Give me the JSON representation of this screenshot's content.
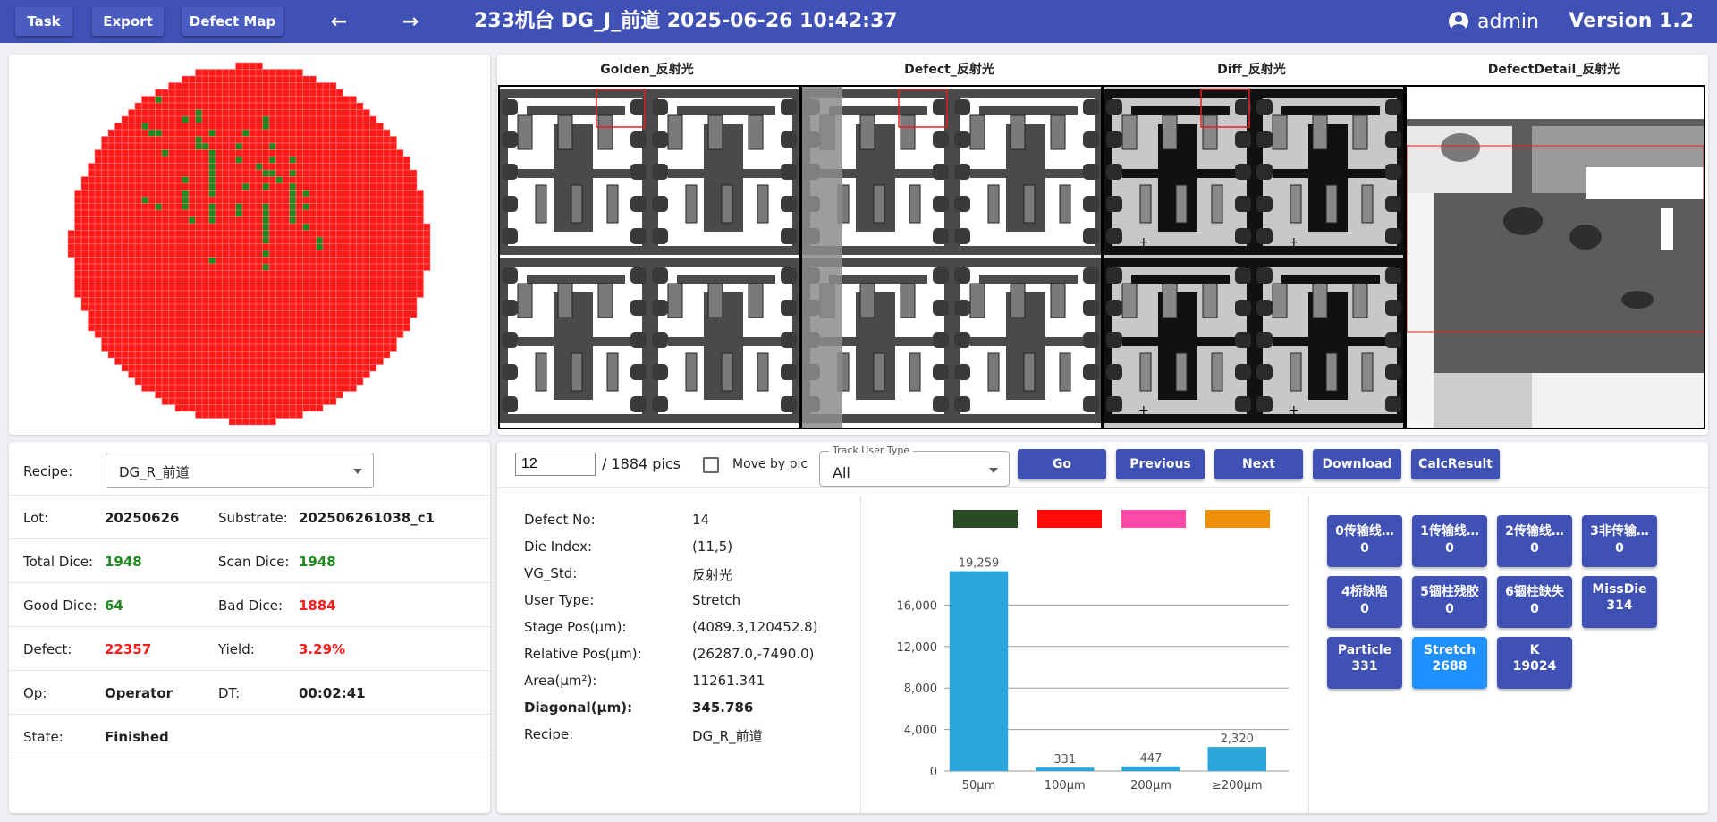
{
  "header": {
    "buttons": [
      "Task",
      "Export",
      "Defect Map"
    ],
    "back_icon": "arrow-left-icon",
    "forward_icon": "arrow-right-icon",
    "title": "233机台   DG_J_前道   2025-06-26 10:42:37",
    "user": "admin",
    "version": "Version 1.2"
  },
  "colors": {
    "header": "#3f51b5",
    "good_die": "#1e8a1e",
    "bad_die": "#ff1a1a",
    "selected_die": "#1033c8",
    "good_text": "#1e8a1e",
    "bad_text": "#ff1a1a",
    "bar": "#2ba6dc"
  },
  "info": {
    "recipe_label": "Recipe:",
    "recipe_value": "DG_R_前道",
    "lot_label": "Lot:",
    "lot_value": "20250626",
    "substrate_label": "Substrate:",
    "substrate_value": "202506261038_c1",
    "total_label": "Total Dice:",
    "total_value": "1948",
    "scan_label": "Scan Dice:",
    "scan_value": "1948",
    "good_label": "Good Dice:",
    "good_value": "64",
    "bad_label": "Bad Dice:",
    "bad_value": "1884",
    "defect_label": "Defect:",
    "defect_value": "22357",
    "yield_label": "Yield:",
    "yield_value": "3.29%",
    "op_label": "Op:",
    "op_value": "Operator",
    "dt_label": "DT:",
    "dt_value": "00:02:41",
    "state_label": "State:",
    "state_value": "Finished"
  },
  "images": {
    "titles": [
      "Golden_反射光",
      "Defect_反射光",
      "Diff_反射光",
      "DefectDetail_反射光"
    ]
  },
  "controls": {
    "pic_value": "12",
    "pic_total": "/ 1884 pics",
    "move_by_pic": "Move by pic",
    "track_label": "Track User Type",
    "track_value": "All",
    "buttons": [
      "Go",
      "Previous",
      "Next",
      "Download",
      "CalcResult"
    ]
  },
  "defect": {
    "rows": [
      {
        "label": "Defect No:",
        "value": "14"
      },
      {
        "label": "Die Index:",
        "value": "(11,5)"
      },
      {
        "label": "VG_Std:",
        "value": "反射光"
      },
      {
        "label": "User Type:",
        "value": "Stretch"
      },
      {
        "label": "Stage Pos(μm):",
        "value": "(4089.3,120452.8)"
      },
      {
        "label": "Relative Pos(μm):",
        "value": "(26287.0,-7490.0)"
      },
      {
        "label": "Area(μm²):",
        "value": "11261.341"
      },
      {
        "label": "Diagonal(μm):",
        "value": "345.786"
      },
      {
        "label": "Recipe:",
        "value": "DG_R_前道"
      }
    ]
  },
  "chart_data": {
    "type": "bar",
    "categories": [
      "50μm",
      "100μm",
      "200μm",
      "≥200μm"
    ],
    "values": [
      19259,
      331,
      447,
      2320
    ],
    "value_labels": [
      "19,259",
      "331",
      "447",
      "2,320"
    ],
    "legend_colors": [
      "#2a4a26",
      "#ff0a0a",
      "#ff4aa8",
      "#f0900a"
    ],
    "yticks": [
      "0",
      "4,000",
      "8,000",
      "12,000",
      "16,000"
    ],
    "ylim": [
      0,
      20000
    ],
    "grid": true,
    "legend_placement": "top"
  },
  "chips": [
    {
      "label": "0传输线…",
      "count": "0"
    },
    {
      "label": "1传输线…",
      "count": "0"
    },
    {
      "label": "2传输线…",
      "count": "0"
    },
    {
      "label": "3非传输…",
      "count": "0"
    },
    {
      "label": "4桥缺陷",
      "count": "0"
    },
    {
      "label": "5锢柱残胶",
      "count": "0"
    },
    {
      "label": "6锢柱缺失",
      "count": "0"
    },
    {
      "label": "MissDie",
      "count": "314"
    },
    {
      "label": "Particle",
      "count": "331"
    },
    {
      "label": "Stretch",
      "count": "2688"
    },
    {
      "label": "K",
      "count": "19024"
    }
  ]
}
